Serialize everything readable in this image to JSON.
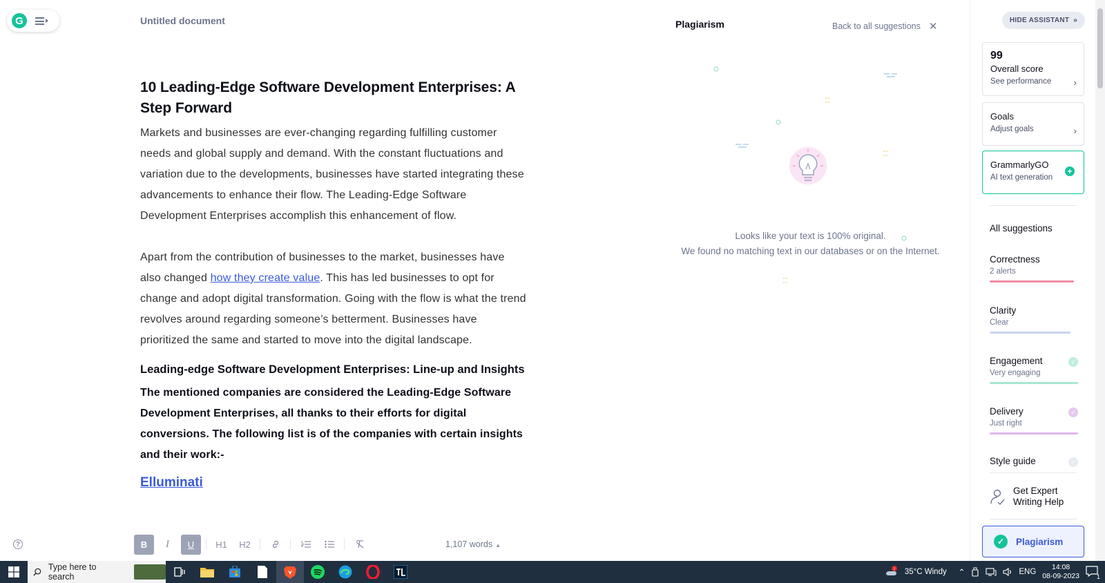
{
  "document": {
    "title": "Untitled document",
    "heading": "10 Leading-Edge Software Development Enterprises: A Step Forward",
    "para1": "Markets and businesses are ever-changing regarding fulfilling customer needs and global supply and demand. With the constant fluctuations and variation due to the developments, businesses have started integrating these advancements to enhance their flow. The Leading-Edge Software Development Enterprises accomplish this enhancement of flow.",
    "para2_before": "Apart from the contribution of businesses to the market, businesses have also changed ",
    "para2_link": "how they create value",
    "para2_after": ". This has led businesses to opt for change and adopt digital transformation. Going with the flow is what the trend revolves around regarding someone’s betterment. Businesses have prioritized the same and started to move into the digital landscape.",
    "subheading": "Leading-edge Software Development Enterprises: Line-up and Insights",
    "bold_para": "The mentioned companies are considered the Leading-Edge Software Development Enterprises, all thanks to their efforts for digital conversions. The following list is of the companies with certain insights and their work:-",
    "list_link": "Elluminati"
  },
  "toolbar": {
    "bold": "B",
    "italic": "I",
    "underline": "U",
    "h1": "H1",
    "h2": "H2",
    "word_count": "1,107 words"
  },
  "plagiarism": {
    "title": "Plagiarism",
    "back_label": "Back to all suggestions",
    "message1": "Looks like your text is 100% original.",
    "message2": "We found no matching text in our databases or on the Internet."
  },
  "assistant": {
    "hide_label": "HIDE ASSISTANT",
    "score": "99",
    "score_title": "Overall score",
    "score_sub": "See performance",
    "goals_title": "Goals",
    "goals_sub": "Adjust goals",
    "go_title": "GrammarlyGO",
    "go_sub": "AI text generation",
    "all_suggestions": "All suggestions",
    "categories": [
      {
        "name": "Correctness",
        "status": "2 alerts",
        "color": "#f28ba4"
      },
      {
        "name": "Clarity",
        "status": "Clear",
        "color": "#c9d3f2"
      },
      {
        "name": "Engagement",
        "status": "Very engaging",
        "color": "#a8e6d3"
      },
      {
        "name": "Delivery",
        "status": "Just right",
        "color": "#e0b8ec"
      },
      {
        "name": "Style guide",
        "status": ""
      }
    ],
    "expert_label": "Get Expert Writing Help",
    "plagiarism_label": "Plagiarism"
  },
  "taskbar": {
    "search_placeholder": "Type here to search",
    "weather": "35°C  Windy",
    "language": "ENG",
    "time": "14:08",
    "date": "08-09-2023",
    "notification_count": "1"
  }
}
